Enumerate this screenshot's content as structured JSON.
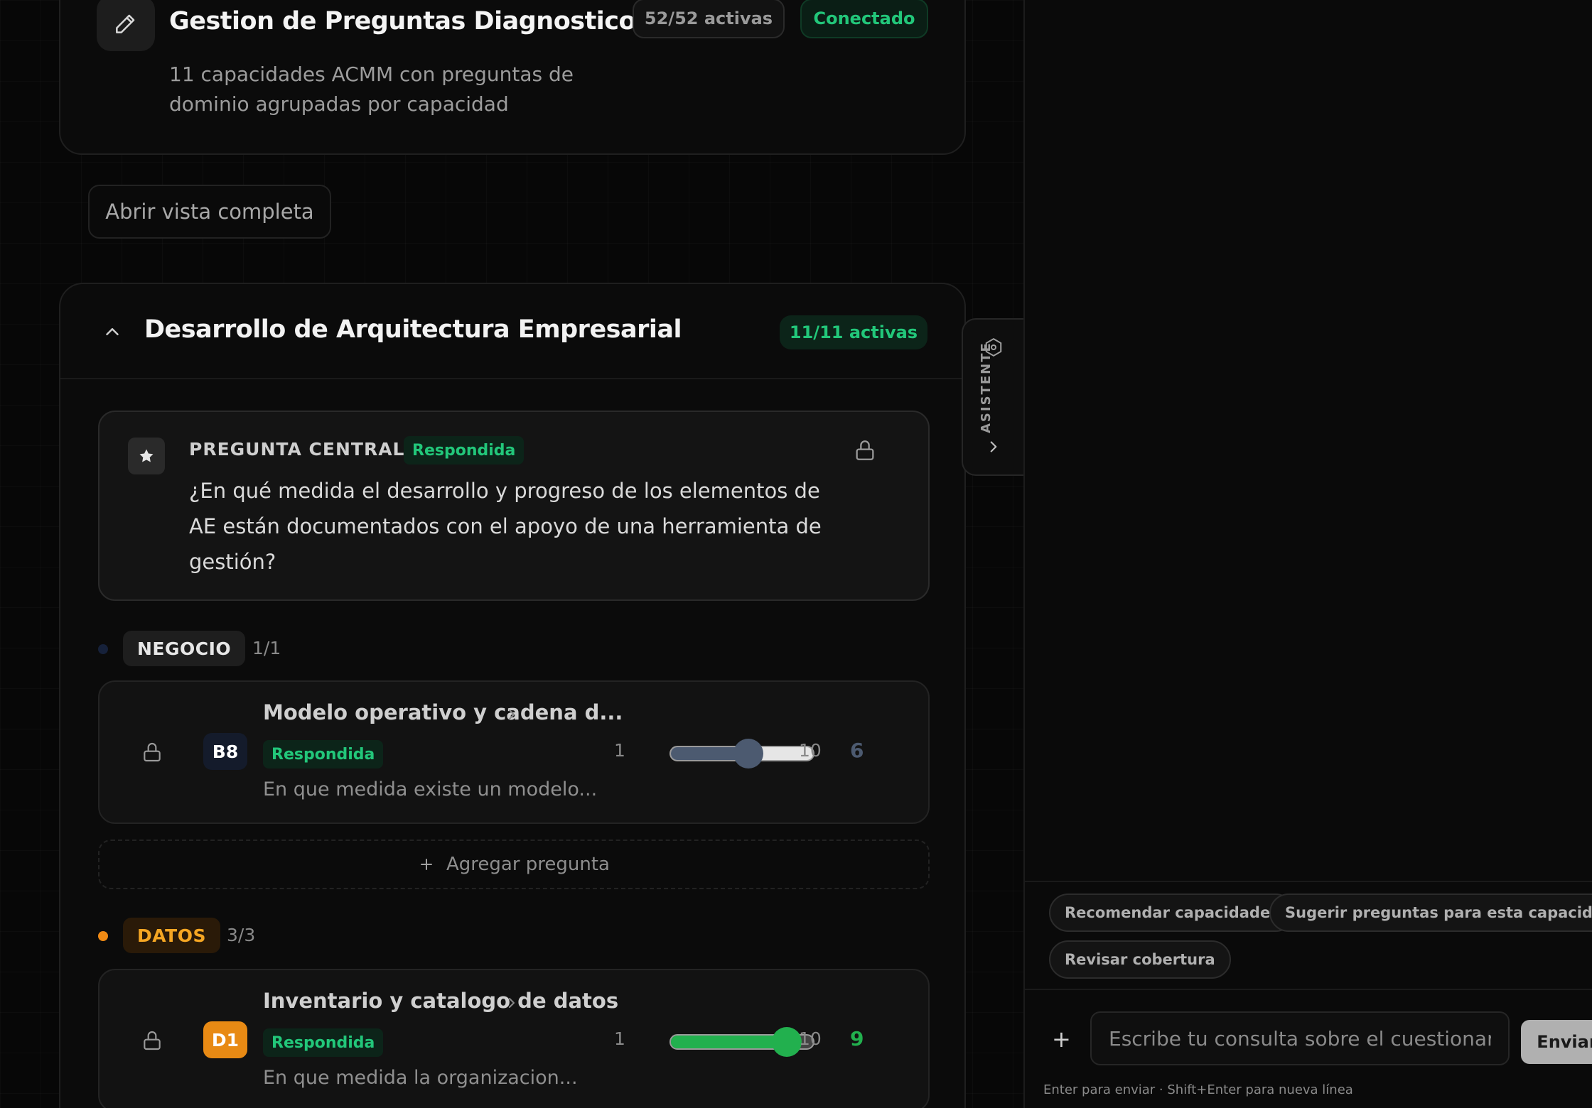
{
  "header": {
    "title": "Gestion de Preguntas Diagnostico",
    "subtitle": "11 capacidades ACMM con preguntas de dominio agrupadas por capacidad",
    "active_count": "52/52 activas",
    "connection_status": "Conectado",
    "edit_icon": "pencil-icon"
  },
  "open_full_view_label": "Abrir vista completa",
  "section": {
    "title": "Desarrollo de Arquitectura Empresarial",
    "active_count": "11/11 activas",
    "central": {
      "label": "PREGUNTA CENTRAL",
      "status": "Respondida",
      "text": "¿En qué medida el desarrollo y progreso de los elementos de AE están documentados con el apoyo de una herramienta de gestión?"
    },
    "groups": [
      {
        "label": "NEGOCIO",
        "count": "1/1",
        "color": "#16213a",
        "questions": [
          {
            "code": "B8",
            "title": "Modelo operativo y cadena d...",
            "status": "Respondida",
            "description": "En que medida existe un modelo...",
            "min": "1",
            "max": "10",
            "value": 6,
            "value_label": "6",
            "color": "#4c5a70"
          }
        ]
      },
      {
        "label": "DATOS",
        "count": "3/3",
        "color": "#f08a14",
        "questions": [
          {
            "code": "D1",
            "title": "Inventario y catalogo de datos",
            "status": "Respondida",
            "description": "En que medida la organizacion...",
            "min": "1",
            "max": "10",
            "value": 9,
            "value_label": "9",
            "color": "#22b04e"
          }
        ]
      }
    ],
    "add_question_label": "Agregar pregunta"
  },
  "assistant": {
    "tab_label": "ASISTENTE",
    "suggestions": [
      "Recomendar capacidades",
      "Sugerir preguntas para esta capacidad",
      "Revisar cobertura"
    ],
    "input_placeholder": "Escribe tu consulta sobre el cuestionario",
    "send_label": "Enviar",
    "hint": "Enter para enviar · Shift+Enter para nueva línea",
    "plus_symbol": "+"
  },
  "colors": {
    "accent_green": "#22c77a",
    "background": "#070707"
  }
}
